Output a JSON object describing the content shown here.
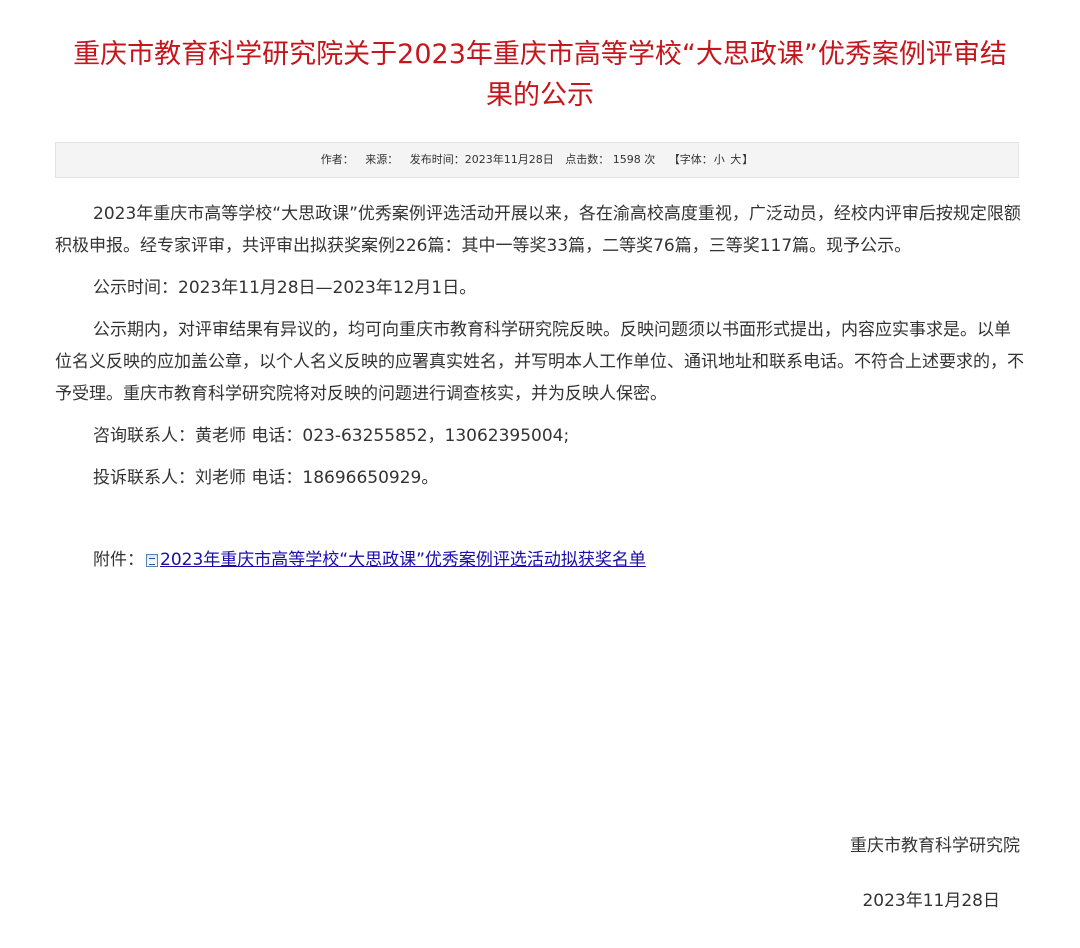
{
  "article": {
    "title": "重庆市教育科学研究院关于2023年重庆市高等学校“大思政课”优秀案例评审结果的公示",
    "meta": {
      "author_label": "作者：",
      "source_label": "来源：",
      "publish_time": "发布时间：2023年11月28日",
      "clicks": "点击数： 1598  次",
      "font_open": "【字体：",
      "font_small": "小",
      "font_large": "大",
      "font_close": "】"
    },
    "paragraphs": {
      "p1": "2023年重庆市高等学校“大思政课”优秀案例评选活动开展以来，各在渝高校高度重视，广泛动员，经校内评审后按规定限额积极申报。经专家评审，共评审出拟获奖案例226篇：其中一等奖33篇，二等奖76篇，三等奖117篇。现予公示。",
      "p2": "公示时间：2023年11月28日—2023年12月1日。",
      "p3": "公示期内，对评审结果有异议的，均可向重庆市教育科学研究院反映。反映问题须以书面形式提出，内容应实事求是。以单位名义反映的应加盖公章，以个人名义反映的应署真实姓名，并写明本人工作单位、通讯地址和联系电话。不符合上述要求的，不予受理。重庆市教育科学研究院将对反映的问题进行调查核实，并为反映人保密。",
      "p4": "咨询联系人：黄老师 电话：023-63255852，13062395004;",
      "p5": "投诉联系人：刘老师 电话：18696650929。"
    },
    "attachment": {
      "label": "附件：",
      "icon": "word-doc-icon",
      "link_text": "2023年重庆市高等学校“大思政课”优秀案例评选活动拟获奖名单"
    },
    "signature": {
      "org": "重庆市教育科学研究院",
      "date": "2023年11月28日"
    }
  },
  "colors": {
    "title": "#c4161c",
    "link": "#1a0dab",
    "text": "#333333",
    "meta_bg": "#f4f4f4"
  }
}
